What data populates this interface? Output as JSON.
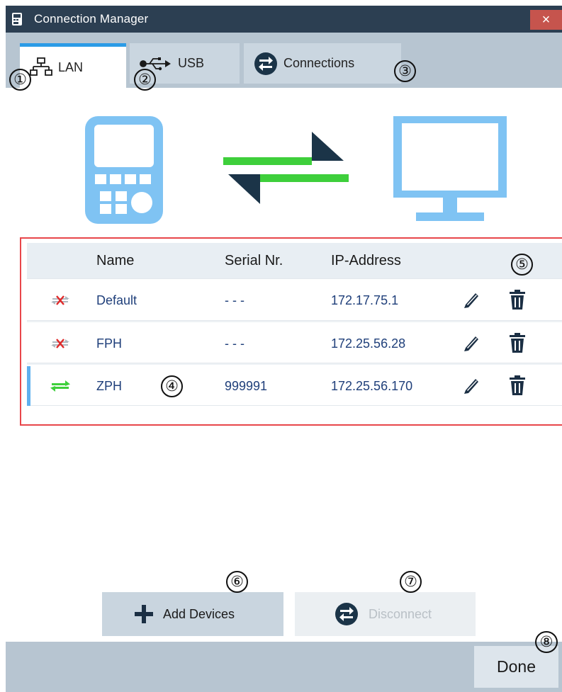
{
  "window": {
    "title": "Connection Manager",
    "close_symbol": "×",
    "accent_color": "#2b9be6",
    "title_bar_color": "#2c3f52",
    "close_color": "#c6544d"
  },
  "tabs": [
    {
      "label": "LAN",
      "icon": "network-icon",
      "active": true
    },
    {
      "label": "USB",
      "icon": "usb-icon",
      "active": false
    },
    {
      "label": "Connections",
      "icon": "connections-icon",
      "active": false
    }
  ],
  "illustration": {
    "device_icon": "handheld-instrument-icon",
    "transfer_icon": "bidirectional-arrows-icon",
    "pc_icon": "monitor-icon"
  },
  "table": {
    "headers": {
      "name": "Name",
      "serial": "Serial Nr.",
      "ip": "IP-Address"
    },
    "rows": [
      {
        "name": "Default",
        "serial": "- - -",
        "ip": "172.17.75.1",
        "status": "disconnected"
      },
      {
        "name": "FPH",
        "serial": "- - -",
        "ip": "172.25.56.28",
        "status": "disconnected"
      },
      {
        "name": "ZPH",
        "serial": "999991",
        "ip": "172.25.56.170",
        "status": "connected"
      }
    ]
  },
  "buttons": {
    "add": "Add Devices",
    "disconnect": "Disconnect",
    "done": "Done"
  },
  "callouts": [
    "①",
    "②",
    "③",
    "④",
    "⑤",
    "⑥",
    "⑦",
    "⑧"
  ]
}
